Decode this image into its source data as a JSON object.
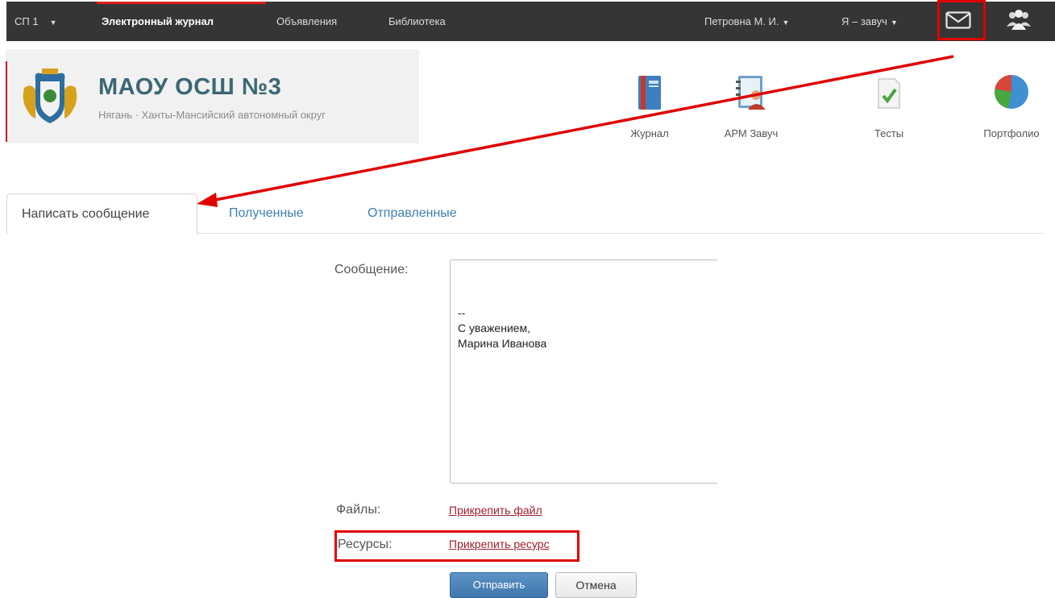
{
  "topbar": {
    "division": "СП 1",
    "division_caret": "▼",
    "nav": [
      "Электронный журнал",
      "Объявления",
      "Библиотека"
    ],
    "user": "Петровна М. И.",
    "role": "Я – завуч",
    "caret": "▼",
    "icons": [
      "mail-icon",
      "users-icon"
    ]
  },
  "school": {
    "title": "МАОУ ОСШ №3",
    "subtitle": "Нягань · Ханты-Мансийский автономный округ"
  },
  "apps": [
    "Журнал",
    "АРМ Завуч",
    "Тесты",
    "Портфолио"
  ],
  "tabs": [
    "Написать сообщение",
    "Полученные",
    "Отправленные"
  ],
  "form": {
    "message_label": "Сообщение:",
    "message_lines": [
      "--",
      "С уважением,",
      "Марина Иванова"
    ],
    "files_label": "Файлы:",
    "files_link": "Прикрепить файл",
    "resources_label": "Ресурсы:",
    "resources_link": "Прикрепить ресурс",
    "send": "Отправить",
    "cancel": "Отмена"
  },
  "colors": {
    "topbar": "#353535",
    "accent_red": "#e00000",
    "link": "#9c1f2c",
    "tab_link": "#3e7fb4",
    "primary_button": "#4a82b8"
  }
}
